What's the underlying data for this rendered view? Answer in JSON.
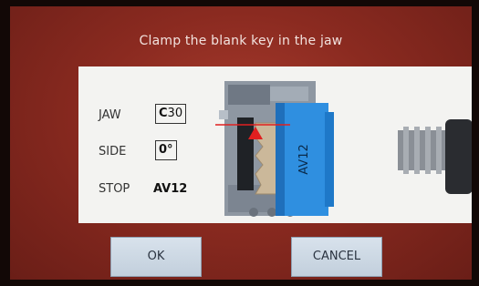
{
  "screen": {
    "title": "Clamp the blank key in the jaw"
  },
  "settings": {
    "jaw": {
      "label": "JAW",
      "code_prefix": "C",
      "code_number": "30"
    },
    "side": {
      "label": "SIDE",
      "value": "0°"
    },
    "stop": {
      "label": "STOP",
      "value": "AV12"
    }
  },
  "illustration": {
    "clamp_label": "AV12"
  },
  "buttons": {
    "ok_label": "OK",
    "cancel_label": "CANCEL"
  },
  "colors": {
    "background": "#8a2a20",
    "panel": "#f3f3f1",
    "clamp_blue": "#2f8fe0",
    "marker_red": "#e02020"
  }
}
